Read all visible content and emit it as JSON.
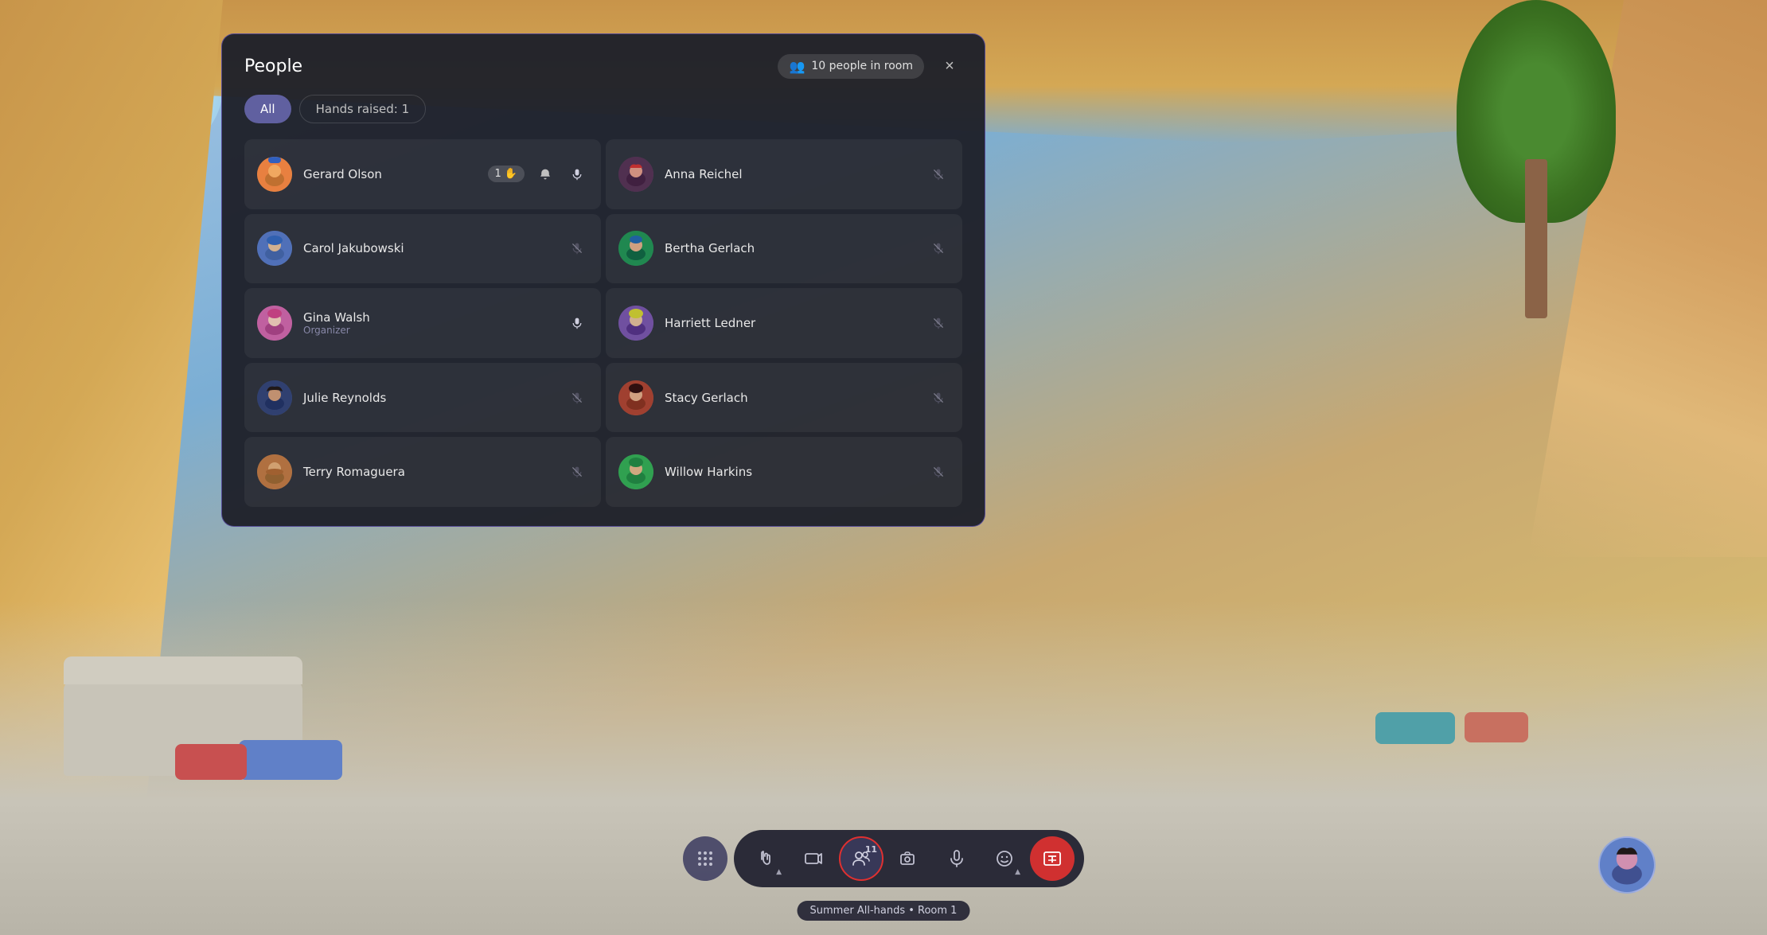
{
  "app": {
    "title": "Summer All-hands • Room 1"
  },
  "panel": {
    "title": "People",
    "people_count_label": "10 people in room",
    "close_label": "×"
  },
  "filters": {
    "all_label": "All",
    "hands_raised_label": "Hands raised: 1"
  },
  "people": [
    {
      "id": 1,
      "name": "Gerard Olson",
      "role": "",
      "avatar_color": "orange",
      "hand_raised": true,
      "hand_count": "1",
      "mic_on": true,
      "muted": false,
      "has_notification": true,
      "col": "left"
    },
    {
      "id": 2,
      "name": "Anna Reichel",
      "role": "",
      "avatar_color": "dark-red",
      "hand_raised": false,
      "mic_on": false,
      "muted": true,
      "col": "right"
    },
    {
      "id": 3,
      "name": "Carol Jakubowski",
      "role": "",
      "avatar_color": "blue",
      "hand_raised": false,
      "mic_on": false,
      "muted": true,
      "col": "left"
    },
    {
      "id": 4,
      "name": "Bertha Gerlach",
      "role": "",
      "avatar_color": "green",
      "hand_raised": false,
      "mic_on": false,
      "muted": true,
      "col": "right"
    },
    {
      "id": 5,
      "name": "Gina Walsh",
      "role": "Organizer",
      "avatar_color": "pink",
      "hand_raised": false,
      "mic_on": true,
      "muted": false,
      "col": "left"
    },
    {
      "id": 6,
      "name": "Harriett Ledner",
      "role": "",
      "avatar_color": "purple-green",
      "hand_raised": false,
      "mic_on": false,
      "muted": true,
      "col": "right"
    },
    {
      "id": 7,
      "name": "Julie Reynolds",
      "role": "",
      "avatar_color": "dark-curly",
      "hand_raised": false,
      "mic_on": false,
      "muted": true,
      "col": "left"
    },
    {
      "id": 8,
      "name": "Stacy Gerlach",
      "role": "",
      "avatar_color": "brown-red",
      "hand_raised": false,
      "mic_on": false,
      "muted": true,
      "col": "right"
    },
    {
      "id": 9,
      "name": "Terry Romaguera",
      "role": "",
      "avatar_color": "brown-beard",
      "hand_raised": false,
      "mic_on": false,
      "muted": true,
      "col": "left"
    },
    {
      "id": 10,
      "name": "Willow Harkins",
      "role": "",
      "avatar_color": "lime",
      "hand_raised": false,
      "mic_on": false,
      "muted": true,
      "col": "right"
    }
  ],
  "toolbar": {
    "grid_label": "⋮⋮⋮",
    "raise_hand_label": "↑",
    "view_label": "🎬",
    "people_label": "👤",
    "people_count": "11",
    "camera_label": "📷",
    "mic_label": "🎤",
    "emoji_label": "😊",
    "end_label": "⊠",
    "tooltip": "Summer All-hands • Room 1"
  },
  "colors": {
    "panel_bg": "#1e2028",
    "panel_border": "#7864dc",
    "active_filter": "#6060a0",
    "muted_color": "#606078",
    "mic_active": "#d0d0e0",
    "end_call_red": "#d03030",
    "highlight_red": "#e03030"
  }
}
